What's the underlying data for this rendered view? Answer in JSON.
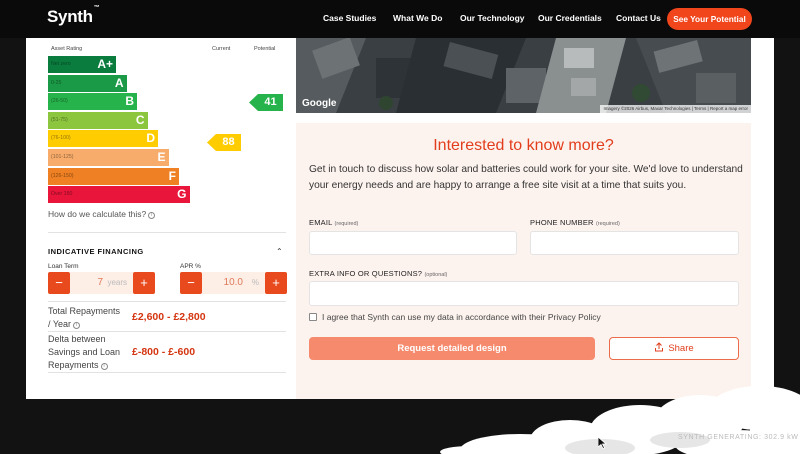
{
  "nav": {
    "logo": "Synth",
    "logo_tm": "™",
    "links": [
      "Case Studies",
      "What We Do",
      "Our Technology",
      "Our Credentials",
      "Contact Us"
    ],
    "cta": "See Your Potential"
  },
  "epc": {
    "col_rating": "Asset Rating",
    "col_current": "Current",
    "col_potential": "Potential",
    "bands": [
      {
        "letter": "A+",
        "range": "Net zero",
        "color": "#0a7d3e"
      },
      {
        "letter": "A",
        "range": "0-25",
        "color": "#1a9a46"
      },
      {
        "letter": "B",
        "range": "(26-50)",
        "color": "#27b34b"
      },
      {
        "letter": "C",
        "range": "(51-75)",
        "color": "#8cc63f"
      },
      {
        "letter": "D",
        "range": "(76-100)",
        "color": "#ffcc00"
      },
      {
        "letter": "E",
        "range": "(101-125)",
        "color": "#f7ac6b"
      },
      {
        "letter": "F",
        "range": "(126-150)",
        "color": "#ef8023"
      },
      {
        "letter": "G",
        "range": "Over 150",
        "color": "#e9153b"
      }
    ],
    "potential_value": "41",
    "potential_color": "#27b34b",
    "current_value": "88",
    "current_color": "#ffcc00",
    "how_link": "How do we calculate this?"
  },
  "financing": {
    "title": "INDICATIVE FINANCING",
    "loan_term_label": "Loan Term",
    "loan_term_value": "7",
    "loan_term_unit": "years",
    "apr_label": "APR %",
    "apr_value": "10.0",
    "apr_unit": "%",
    "minus": "−",
    "plus": "+",
    "total_label_1": "Total Repayments",
    "total_label_2": "/ Year",
    "total_value": "£2,600 - £2,800",
    "delta_label_1": "Delta between",
    "delta_label_2": "Savings and Loan",
    "delta_label_3": "Repayments",
    "delta_value": "£-800 - £-600"
  },
  "map": {
    "google": "Google",
    "attribution": "Imagery ©2026 Airbus, Maxar Technologies  |  Terms  |  Report a map error"
  },
  "form": {
    "title": "Interested to know more?",
    "description": "Get in touch to discuss how solar and batteries could work for your site. We'd love to understand your energy needs and are happy to arrange a free site visit at a time that suits you.",
    "email_label": "EMAIL",
    "phone_label": "PHONE NUMBER",
    "required": "(required)",
    "extra_label": "EXTRA INFO OR QUESTIONS?",
    "optional": "(optional)",
    "consent": "I agree that Synth can use my data in accordance with their Privacy Policy",
    "submit": "Request detailed design",
    "share": "Share"
  },
  "status": "SYNTH GENERATING: 302.9 kW"
}
